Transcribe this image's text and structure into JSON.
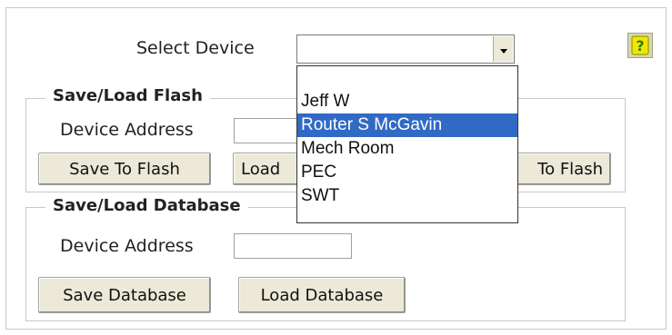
{
  "select_device": {
    "label": "Select Device",
    "value": "",
    "options": [
      "",
      "Jeff W",
      "Router S McGavin",
      "Mech Room",
      "PEC",
      "SWT"
    ],
    "highlighted": "Router S McGavin"
  },
  "help_button": {
    "glyph": "?",
    "icon": "help-icon"
  },
  "flash_group": {
    "legend": "Save/Load Flash",
    "device_address_label": "Device Address",
    "device_address_value": "",
    "save_label": "Save To Flash",
    "load_label": "Load",
    "third_label": "To Flash"
  },
  "db_group": {
    "legend": "Save/Load Database",
    "device_address_label": "Device Address",
    "device_address_value": "",
    "save_label": "Save Database",
    "load_label": "Load Database"
  },
  "colors": {
    "highlight": "#316ac5",
    "button_face": "#ece9d8"
  }
}
